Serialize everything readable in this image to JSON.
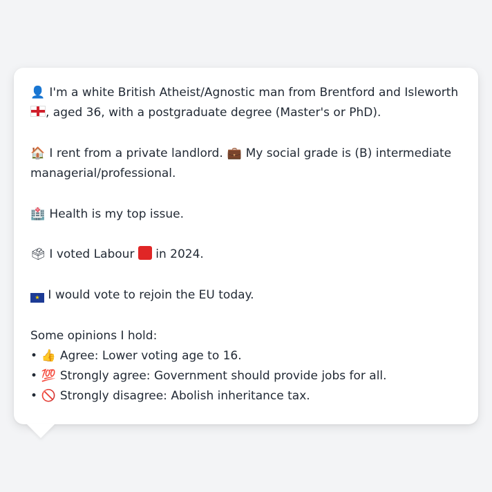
{
  "profile": {
    "line1": {
      "icon": "person-silhouette-icon",
      "text_a": "I'm a white British Atheist/Agnostic man from Brentford and Isleworth",
      "flag": "england-flag-icon",
      "text_b": ", aged 36, with a postgraduate degree (Master's or PhD)."
    },
    "line2": {
      "icon_a": "house-icon",
      "text_a": "I rent from a private landlord.",
      "icon_b": "briefcase-icon",
      "text_b": "My social grade is (B) intermediate managerial/professional."
    },
    "line3": {
      "icon": "hospital-icon",
      "text": "Health is my top issue."
    },
    "line4": {
      "icon": "ballot-box-icon",
      "text_a": "I voted Labour",
      "square": "red-square-icon",
      "square_color": "#e02626",
      "text_b": "in 2024."
    },
    "line5": {
      "icon": "eu-flag-icon",
      "text": "I would vote to rejoin the EU today."
    },
    "opinions": {
      "heading": "Some opinions I hold:",
      "bullet": "•",
      "items": [
        {
          "icon": "thumbs-up-icon",
          "glyph": "👍",
          "text": "Agree: Lower voting age to 16."
        },
        {
          "icon": "hundred-points-icon",
          "glyph": "💯",
          "text": "Strongly agree: Government should provide jobs for all."
        },
        {
          "icon": "no-entry-icon",
          "glyph": "🚫",
          "text": "Strongly disagree: Abolish inheritance tax."
        }
      ]
    }
  },
  "colors": {
    "background": "#f3f4f6",
    "card": "#ffffff",
    "text": "#222a35"
  }
}
